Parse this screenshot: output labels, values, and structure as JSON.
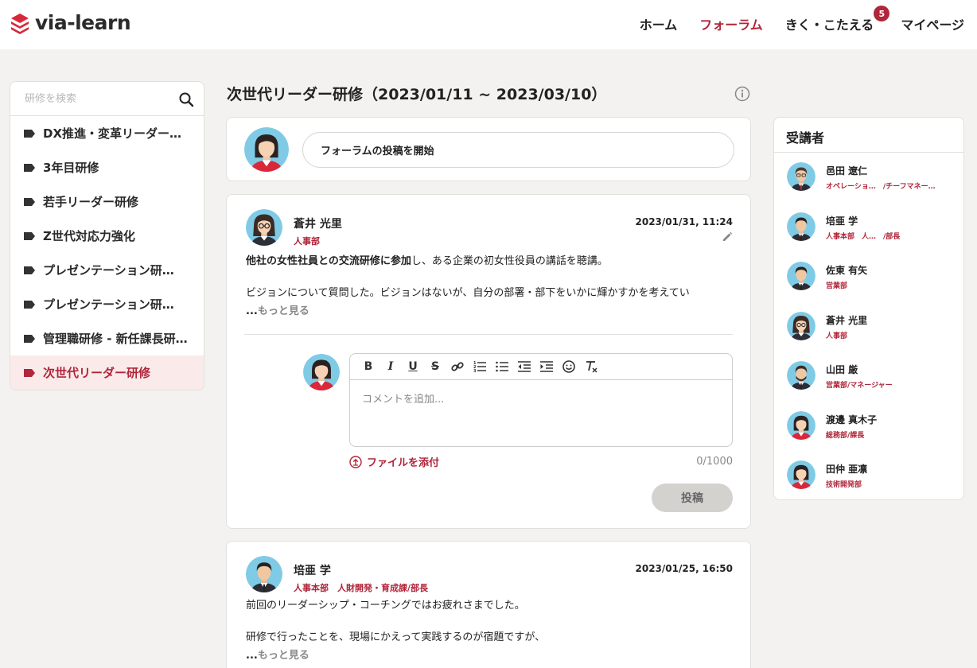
{
  "header": {
    "logo_text": "via-learn",
    "nav": [
      {
        "label": "ホーム"
      },
      {
        "label": "フォーラム"
      },
      {
        "label": "きく・こたえる",
        "badge": "5"
      },
      {
        "label": "マイページ"
      }
    ]
  },
  "sidebar": {
    "search_placeholder": "研修を検索",
    "items": [
      {
        "label": "DX推進・変革リーダー…"
      },
      {
        "label": "3年目研修"
      },
      {
        "label": "若手リーダー研修"
      },
      {
        "label": "Z世代対応力強化"
      },
      {
        "label": "プレゼンテーション研…"
      },
      {
        "label": "プレゼンテーション研…"
      },
      {
        "label": "管理職研修 - 新任課長研…"
      },
      {
        "label": "次世代リーダー研修"
      }
    ]
  },
  "main": {
    "title": "次世代リーダー研修（2023/01/11 ~ 2023/03/10）",
    "composer_label": "フォーラムの投稿を開始",
    "posts": [
      {
        "author": "蒼井 光里",
        "dept": "人事部",
        "date": "2023/01/31, 11:24",
        "line1_bold": "他社の女性社員との交流研修に参加",
        "line1_rest": "し、ある企業の初女性役員の講話を聴講。",
        "line2": "ビジョンについて質問した。ビジョンはないが、自分の部署・部下をいかに輝かすかを考えてい",
        "more_prefix": "...",
        "more_label": "もっと見る"
      },
      {
        "author": "培亜 学",
        "dept": "人事本部　人財開発・育成課/部長",
        "date": "2023/01/25, 16:50",
        "line1": "前回のリーダーシップ・コーチングではお疲れさまでした。",
        "line2": "研修で行ったことを、現場にかえって実践するのが宿題ですが、",
        "more_prefix": "...",
        "more_label": "もっと見る"
      }
    ],
    "comment": {
      "placeholder": "コメントを追加...",
      "attach_label": "ファイルを添付",
      "counter": "0/1000",
      "submit_label": "投稿"
    }
  },
  "participants": {
    "title": "受講者",
    "items": [
      {
        "name": "邑田 遼仁",
        "dept": "オペレーショ…　/チーフマネー…"
      },
      {
        "name": "培亜 学",
        "dept": "人事本部　人…　/部長"
      },
      {
        "name": "佐東 有矢",
        "dept": "営業部"
      },
      {
        "name": "蒼井 光里",
        "dept": "人事部"
      },
      {
        "name": "山田 厳",
        "dept": "営業部/マネージャー"
      },
      {
        "name": "渡邊 真木子",
        "dept": "総務部/課長"
      },
      {
        "name": "田仲 亜凛",
        "dept": "技術開発部"
      }
    ]
  },
  "colors": {
    "accent": "#b0263a",
    "avatar_bg": "#7fcbe6",
    "page_bg": "#f3f2f0"
  }
}
